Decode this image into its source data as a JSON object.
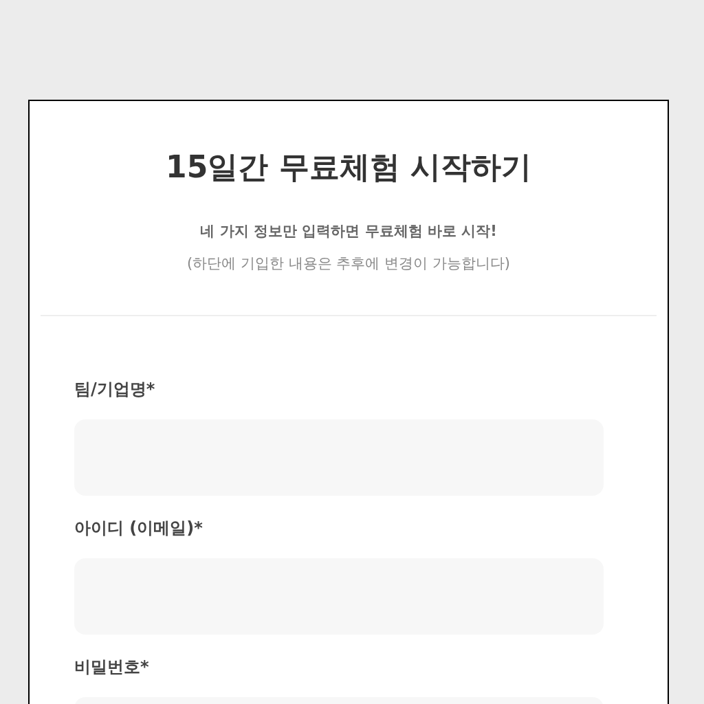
{
  "title": "15일간 무료체험 시작하기",
  "subtitle": "네 가지 정보만 입력하면 무료체험 바로 시작!",
  "note": "(하단에 기입한 내용은 추후에 변경이 가능합니다)",
  "fields": [
    {
      "label": "팀/기업명*"
    },
    {
      "label": "아이디 (이메일)*"
    },
    {
      "label": "비밀번호*"
    }
  ]
}
